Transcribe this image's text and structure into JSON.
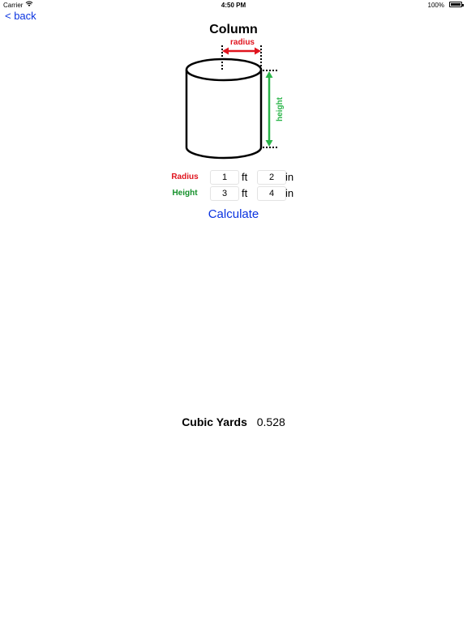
{
  "status_bar": {
    "carrier": "Carrier",
    "time": "4:50 PM",
    "battery": "100%"
  },
  "nav": {
    "back_label": "< back"
  },
  "title": "Column",
  "diagram": {
    "radius_label": "radius",
    "height_label": "height",
    "radius_color": "#e0141e",
    "height_color": "#2bb54a"
  },
  "form": {
    "radius": {
      "label": "Radius",
      "ft": "1",
      "ft_unit": "ft",
      "in": "2",
      "in_unit": "in"
    },
    "height": {
      "label": "Height",
      "ft": "3",
      "ft_unit": "ft",
      "in": "4",
      "in_unit": "in"
    }
  },
  "calculate_label": "Calculate",
  "result": {
    "label": "Cubic Yards",
    "value": "0.528"
  },
  "colors": {
    "link": "#0a33e0",
    "radius": "#e0141e",
    "height": "#14902a"
  }
}
